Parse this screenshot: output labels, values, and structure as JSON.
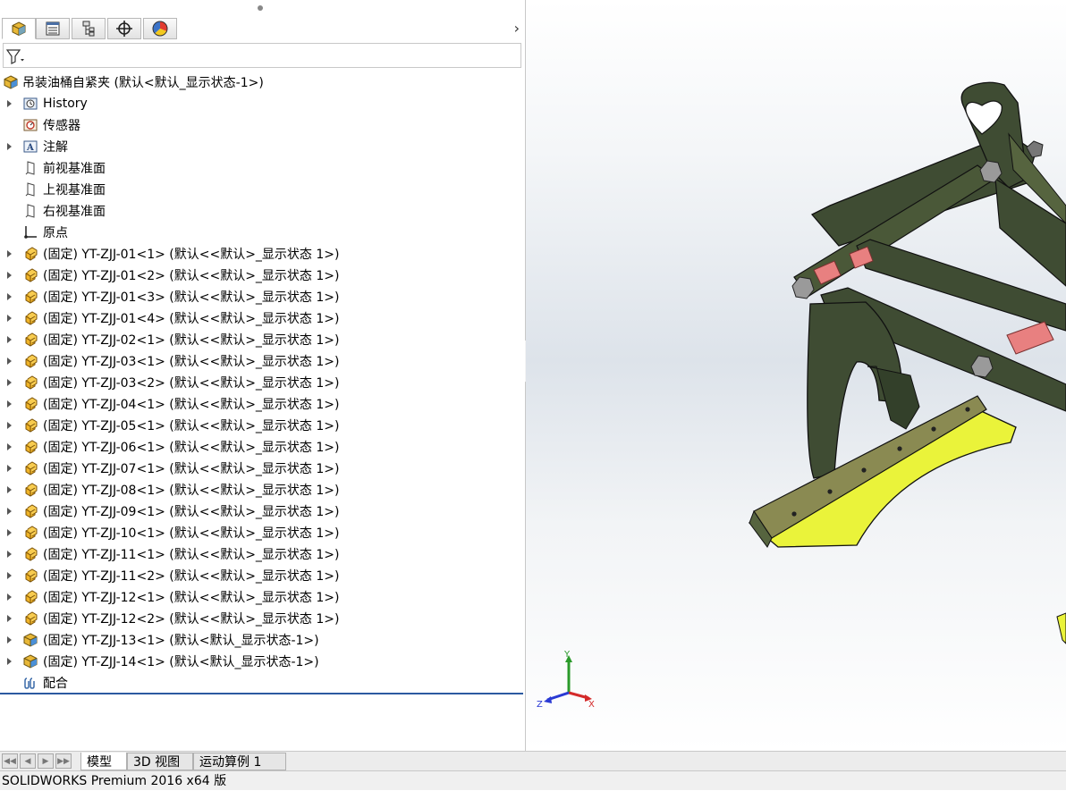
{
  "tree": {
    "root": "吊装油桶自紧夹  (默认<默认_显示状态-1>)",
    "items": [
      {
        "label": "History",
        "arrow": true,
        "icon": "history-folder-icon"
      },
      {
        "label": "传感器",
        "arrow": false,
        "icon": "sensor-icon"
      },
      {
        "label": "注解",
        "arrow": true,
        "icon": "annotation-icon"
      },
      {
        "label": "前视基准面",
        "arrow": false,
        "icon": "plane-icon"
      },
      {
        "label": "上视基准面",
        "arrow": false,
        "icon": "plane-icon"
      },
      {
        "label": "右视基准面",
        "arrow": false,
        "icon": "plane-icon"
      },
      {
        "label": "原点",
        "arrow": false,
        "icon": "origin-icon"
      },
      {
        "label": "(固定) YT-ZJJ-01<1> (默认<<默认>_显示状态 1>)",
        "arrow": true,
        "icon": "subassembly-icon"
      },
      {
        "label": "(固定) YT-ZJJ-01<2> (默认<<默认>_显示状态 1>)",
        "arrow": true,
        "icon": "subassembly-icon"
      },
      {
        "label": "(固定) YT-ZJJ-01<3> (默认<<默认>_显示状态 1>)",
        "arrow": true,
        "icon": "subassembly-icon"
      },
      {
        "label": "(固定) YT-ZJJ-01<4> (默认<<默认>_显示状态 1>)",
        "arrow": true,
        "icon": "subassembly-icon"
      },
      {
        "label": "(固定) YT-ZJJ-02<1> (默认<<默认>_显示状态 1>)",
        "arrow": true,
        "icon": "subassembly-icon"
      },
      {
        "label": "(固定) YT-ZJJ-03<1> (默认<<默认>_显示状态 1>)",
        "arrow": true,
        "icon": "subassembly-icon"
      },
      {
        "label": "(固定) YT-ZJJ-03<2> (默认<<默认>_显示状态 1>)",
        "arrow": true,
        "icon": "subassembly-icon"
      },
      {
        "label": "(固定) YT-ZJJ-04<1> (默认<<默认>_显示状态 1>)",
        "arrow": true,
        "icon": "subassembly-icon"
      },
      {
        "label": "(固定) YT-ZJJ-05<1> (默认<<默认>_显示状态 1>)",
        "arrow": true,
        "icon": "subassembly-icon"
      },
      {
        "label": "(固定) YT-ZJJ-06<1> (默认<<默认>_显示状态 1>)",
        "arrow": true,
        "icon": "subassembly-icon"
      },
      {
        "label": "(固定) YT-ZJJ-07<1> (默认<<默认>_显示状态 1>)",
        "arrow": true,
        "icon": "subassembly-icon"
      },
      {
        "label": "(固定) YT-ZJJ-08<1> (默认<<默认>_显示状态 1>)",
        "arrow": true,
        "icon": "subassembly-icon"
      },
      {
        "label": "(固定) YT-ZJJ-09<1> (默认<<默认>_显示状态 1>)",
        "arrow": true,
        "icon": "subassembly-icon"
      },
      {
        "label": "(固定) YT-ZJJ-10<1> (默认<<默认>_显示状态 1>)",
        "arrow": true,
        "icon": "subassembly-icon"
      },
      {
        "label": "(固定) YT-ZJJ-11<1> (默认<<默认>_显示状态 1>)",
        "arrow": true,
        "icon": "subassembly-icon"
      },
      {
        "label": "(固定) YT-ZJJ-11<2> (默认<<默认>_显示状态 1>)",
        "arrow": true,
        "icon": "subassembly-icon"
      },
      {
        "label": "(固定) YT-ZJJ-12<1> (默认<<默认>_显示状态 1>)",
        "arrow": true,
        "icon": "subassembly-icon"
      },
      {
        "label": "(固定) YT-ZJJ-12<2> (默认<<默认>_显示状态 1>)",
        "arrow": true,
        "icon": "subassembly-icon"
      },
      {
        "label": "(固定) YT-ZJJ-13<1> (默认<默认_显示状态-1>)",
        "arrow": true,
        "icon": "part-icon"
      },
      {
        "label": "(固定) YT-ZJJ-14<1> (默认<默认_显示状态-1>)",
        "arrow": true,
        "icon": "part-icon"
      },
      {
        "label": "配合",
        "arrow": false,
        "icon": "mates-icon"
      }
    ]
  },
  "panel_tabs": [
    {
      "icon": "feature-manager-icon",
      "active": true
    },
    {
      "icon": "property-manager-icon",
      "active": false
    },
    {
      "icon": "configuration-manager-icon",
      "active": false
    },
    {
      "icon": "dimxpert-icon",
      "active": false
    },
    {
      "icon": "display-manager-icon",
      "active": false
    }
  ],
  "triad": {
    "x": "X",
    "y": "Y",
    "z": "Z"
  },
  "bottom_tabs": [
    {
      "label": "模型",
      "active": true
    },
    {
      "label": "3D 视图",
      "active": false
    },
    {
      "label": "运动算例 1",
      "active": false
    }
  ],
  "status": {
    "text": "SOLIDWORKS Premium 2016 x64 版"
  },
  "colors": {
    "frame": "#3f4c33",
    "plate": "#eaf33a",
    "pin": "#e88080",
    "bolt": "#9a9a9a",
    "tree_line": "#2c5aa0"
  }
}
